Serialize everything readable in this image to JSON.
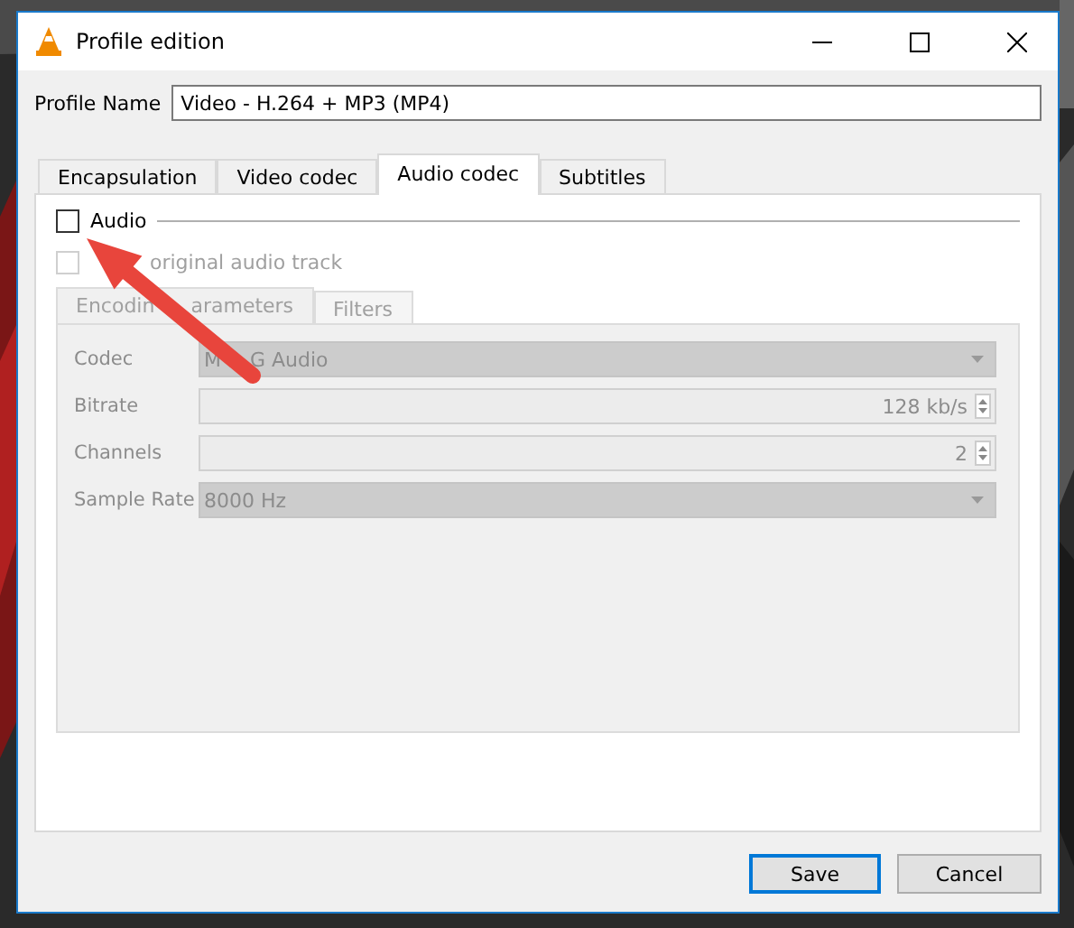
{
  "window": {
    "title": "Profile edition"
  },
  "profile_name": {
    "label": "Profile Name",
    "value": "Video - H.264 + MP3 (MP4)"
  },
  "tabs": [
    {
      "label": "Encapsulation",
      "selected": false
    },
    {
      "label": "Video codec",
      "selected": false
    },
    {
      "label": "Audio codec",
      "selected": true
    },
    {
      "label": "Subtitles",
      "selected": false
    }
  ],
  "audio": {
    "label": "Audio",
    "checked": false
  },
  "keep_original": {
    "label": "original audio track",
    "checked": false,
    "disabled": true
  },
  "inner_tabs": [
    {
      "label_parts": [
        "Encodin",
        "arameters"
      ],
      "selected": true
    },
    {
      "label_parts": [
        "Filters"
      ],
      "selected": false
    }
  ],
  "fields": [
    {
      "kind": "combo",
      "label": "Codec",
      "value_parts": [
        "M",
        "G Audio"
      ]
    },
    {
      "kind": "spinner",
      "label": "Bitrate",
      "value_parts": [
        "128 kb/s"
      ]
    },
    {
      "kind": "spinner",
      "label": "Channels",
      "value_parts": [
        "2"
      ]
    },
    {
      "kind": "combo",
      "label": "Sample Rate",
      "value_parts": [
        "8000 Hz"
      ]
    }
  ],
  "fields_disabled": true,
  "buttons": [
    {
      "label": "Save",
      "default": true
    },
    {
      "label": "Cancel",
      "default": false
    }
  ]
}
